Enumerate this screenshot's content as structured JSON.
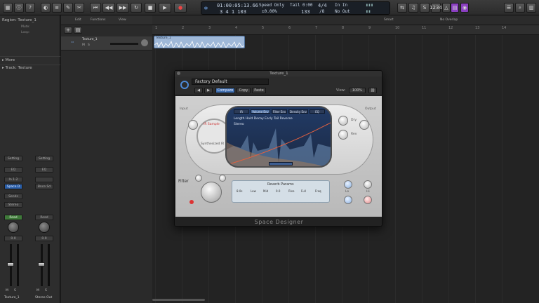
{
  "transport_lcd": {
    "position_smpte": "01:00:05:13.66",
    "position_bars": "3 4 1 103",
    "speed_label": "Speed Only",
    "speed_value": "±0.00%",
    "tempo_label": "Tail 0:00",
    "tempo_value": "133",
    "signature": "4/4",
    "signature_sub": "/8",
    "key_in": "In In",
    "key_out": "No Out"
  },
  "toolbar": {
    "rewind": "⏮",
    "back": "◀◀",
    "forward": "▶▶",
    "stop": "■",
    "play": "▶",
    "record": "●"
  },
  "inspector": {
    "region_label": "Region: Texture_1",
    "mute_label": "Mute:",
    "loop_label": "Loop:",
    "more_label": "▸ More",
    "track_label": "▸ Track: Texture",
    "strip_left": {
      "setting": "Setting",
      "eq": "EQ",
      "input": "In 1-2",
      "plugin": "Space D",
      "sends": "Sends",
      "output": "Stereo Out",
      "group": "Read",
      "value": "0.0",
      "name": "Texture_1",
      "m": "M",
      "s": "S"
    },
    "strip_right": {
      "setting": "Setting",
      "eq": "EQ",
      "input": "",
      "plugin": "Bnce Sd",
      "sends": "",
      "output": "",
      "group": "Read",
      "value": "0.0",
      "name": "Stereo Out",
      "m": "M",
      "s": "S"
    }
  },
  "edit_bar": {
    "edit": "Edit",
    "functions": "Functions",
    "view": "View",
    "snap": "Smart",
    "drag": "No Overlap"
  },
  "ruler_marks": [
    "1",
    "2",
    "3",
    "4",
    "5",
    "6",
    "7",
    "8",
    "9",
    "10",
    "11",
    "12",
    "13",
    "14"
  ],
  "region": {
    "title": "Texture_1"
  },
  "plugin": {
    "window_title": "Texture_1",
    "preset": "Factory Default",
    "compare": "Compare",
    "copy": "Copy",
    "paste": "Paste",
    "view_label": "View:",
    "view_value": "100%",
    "footer": "Space Designer",
    "input_label": "Input",
    "output_label": "Output",
    "ir_sample": "IR Sample",
    "synthesized": "Synthesized IR",
    "filter_label": "Filter",
    "screen_tabs": [
      "IR",
      "Volume Env",
      "Filter Env",
      "Density Env",
      "EQ"
    ],
    "screen_text_1": "Length  Hold  Decay  Early  Tail  Reverse",
    "screen_text_2": "Stereo",
    "lcd_title": "Reverb Params",
    "lcd_values": [
      "8.0s",
      "Low",
      "Mid",
      "0.0",
      "Rise",
      "Full",
      "Freq"
    ],
    "dry_label": "Dry",
    "rev_label": "Rev",
    "lo_label": "Lo",
    "hi_label": "Hi"
  }
}
